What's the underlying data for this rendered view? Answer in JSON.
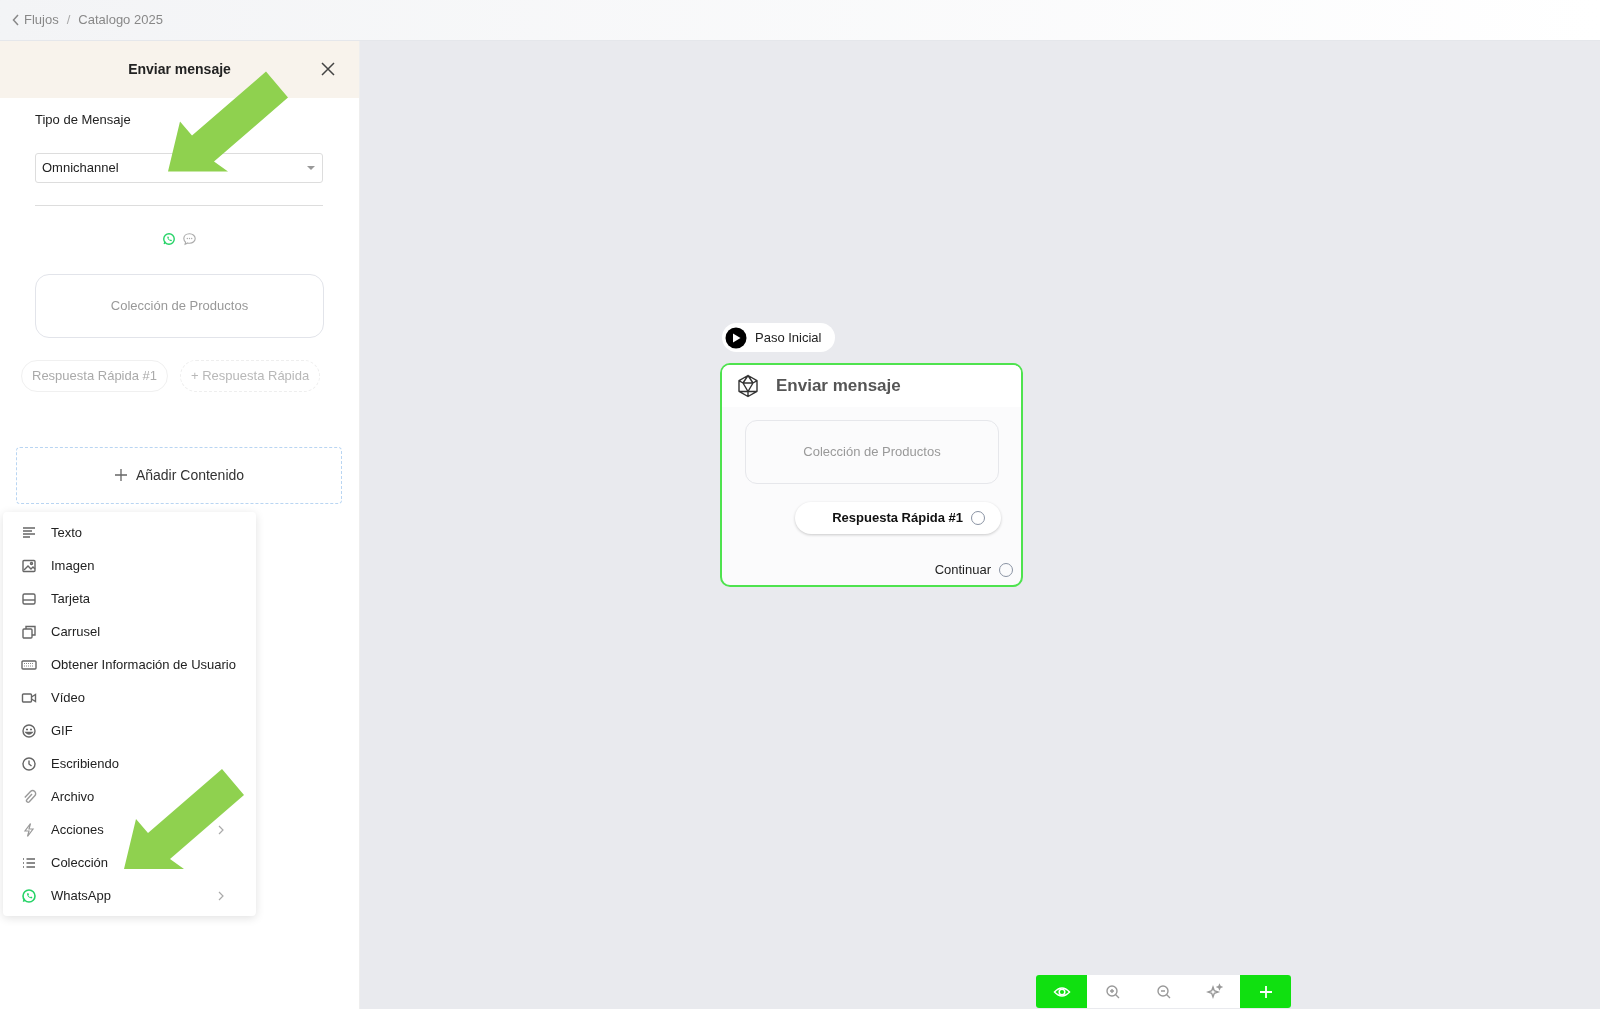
{
  "breadcrumb": {
    "back": "Flujos",
    "separator": "/",
    "current": "Catalogo 2025"
  },
  "panel": {
    "title": "Enviar mensaje",
    "field_label": "Tipo de Mensaje",
    "select_value": "Omnichannel",
    "preview_text": "Colección de Productos",
    "quick_replies": [
      {
        "label": "Respuesta Rápida #1",
        "kind": "reply"
      },
      {
        "label": "+ Respuesta Rápida",
        "kind": "add"
      }
    ],
    "add_content": "Añadir Contenido"
  },
  "menu": [
    {
      "label": "Texto",
      "submenu": false
    },
    {
      "label": "Imagen",
      "submenu": false
    },
    {
      "label": "Tarjeta",
      "submenu": false
    },
    {
      "label": "Carrusel",
      "submenu": false
    },
    {
      "label": "Obtener Información de Usuario",
      "submenu": false
    },
    {
      "label": "Vídeo",
      "submenu": false
    },
    {
      "label": "GIF",
      "submenu": false
    },
    {
      "label": "Escribiendo",
      "submenu": false
    },
    {
      "label": "Archivo",
      "submenu": false
    },
    {
      "label": "Acciones",
      "submenu": true
    },
    {
      "label": "Colección",
      "submenu": false
    },
    {
      "label": "WhatsApp",
      "submenu": true
    }
  ],
  "canvas": {
    "start": "Paso Inicial",
    "node": {
      "title": "Enviar mensaje",
      "content": "Colección de Productos",
      "quick_reply": "Respuesta Rápida #1",
      "continue": "Continuar"
    }
  }
}
